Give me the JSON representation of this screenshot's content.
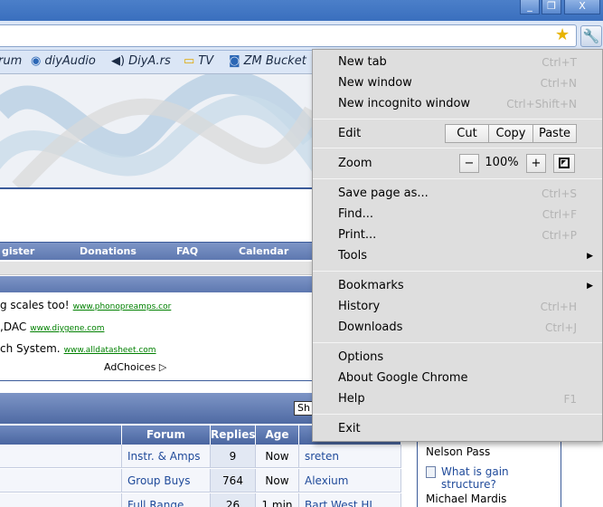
{
  "window": {
    "minimize": "_",
    "restore": "❐",
    "close": "X"
  },
  "bookmarks": [
    {
      "label": "rum",
      "icon": "forum-icon"
    },
    {
      "label": "diyAudio",
      "icon": "diyaudio-icon"
    },
    {
      "label": "DiyA.rs",
      "icon": "speaker-icon"
    },
    {
      "label": "TV",
      "icon": "folder-icon"
    },
    {
      "label": "ZM Bucket",
      "icon": "camera-icon"
    }
  ],
  "page": {
    "nav": {
      "register": "gister",
      "donations": "Donations",
      "faq": "FAQ",
      "calendar": "Calendar"
    },
    "ads": [
      {
        "text": "g scales too!",
        "url": "www.phonopreamps.cor"
      },
      {
        "text": ",DAC",
        "url": "www.diygene.com"
      },
      {
        "text": "ch System.",
        "url": "www.alldatasheet.com"
      }
    ],
    "adchoices": "AdChoices",
    "show_button": "Sh",
    "table": {
      "headers": {
        "forum": "Forum",
        "replies": "Replies",
        "age": "Age"
      },
      "rows": [
        {
          "forum": "Instr. & Amps",
          "replies": "9",
          "age": "Now",
          "user": "sreten"
        },
        {
          "forum": "Group Buys",
          "replies": "764",
          "age": "Now",
          "user": "Alexium"
        },
        {
          "forum": "Full Range",
          "replies": "26",
          "age": "1 min",
          "user": "Bart West HI"
        }
      ]
    },
    "sidebar": {
      "name1": "Nelson Pass",
      "link1_line1": "What is gain",
      "link1_line2": "structure?",
      "name2": "Michael Mardis"
    }
  },
  "menu": {
    "new_tab": "New tab",
    "new_tab_sc": "Ctrl+T",
    "new_window": "New window",
    "new_window_sc": "Ctrl+N",
    "new_incognito": "New incognito window",
    "new_incognito_sc": "Ctrl+Shift+N",
    "edit": "Edit",
    "cut": "Cut",
    "copy": "Copy",
    "paste": "Paste",
    "zoom": "Zoom",
    "zoom_minus": "−",
    "zoom_value": "100%",
    "zoom_plus": "+",
    "save_page": "Save page as...",
    "save_page_sc": "Ctrl+S",
    "find": "Find...",
    "find_sc": "Ctrl+F",
    "print": "Print...",
    "print_sc": "Ctrl+P",
    "tools": "Tools",
    "bookmarks": "Bookmarks",
    "history": "History",
    "history_sc": "Ctrl+H",
    "downloads": "Downloads",
    "downloads_sc": "Ctrl+J",
    "options": "Options",
    "about": "About Google Chrome",
    "help": "Help",
    "help_sc": "F1",
    "exit": "Exit"
  }
}
